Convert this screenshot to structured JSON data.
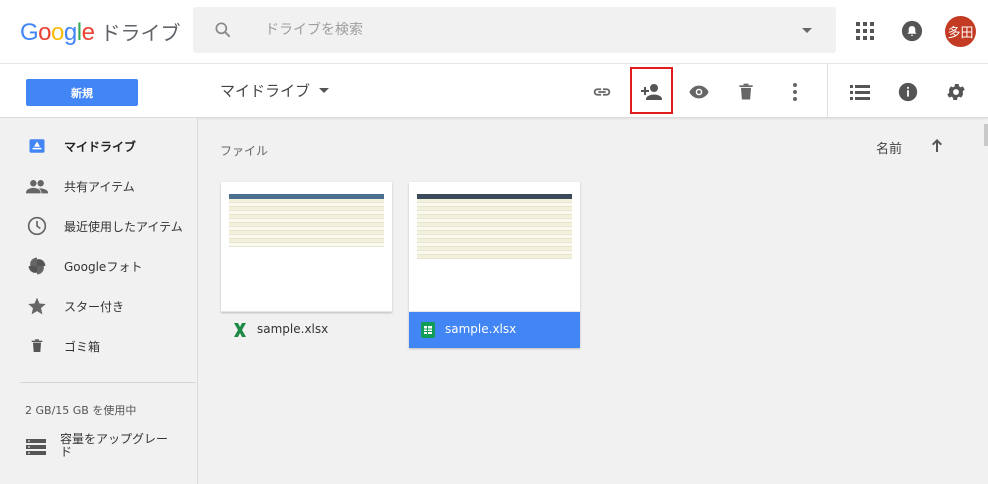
{
  "header": {
    "logo_google": "Google",
    "logo_product": "ドライブ",
    "search_placeholder": "ドライブを検索",
    "avatar_text": "多田"
  },
  "toolbar": {
    "new_label": "新規",
    "breadcrumb": "マイドライブ",
    "icons": [
      "link-icon",
      "add-person-icon",
      "eye-icon",
      "trash-icon",
      "more-vert-icon",
      "list-view-icon",
      "info-icon",
      "settings-icon"
    ],
    "highlighted": "add-person-icon"
  },
  "sidebar": {
    "items": [
      {
        "label": "マイドライブ",
        "icon": "drive-icon",
        "active": true
      },
      {
        "label": "共有アイテム",
        "icon": "people-icon",
        "active": false
      },
      {
        "label": "最近使用したアイテム",
        "icon": "clock-icon",
        "active": false
      },
      {
        "label": "Googleフォト",
        "icon": "photos-icon",
        "active": false
      },
      {
        "label": "スター付き",
        "icon": "star-icon",
        "active": false
      },
      {
        "label": "ゴミ箱",
        "icon": "trash-icon",
        "active": false
      }
    ],
    "storage": "2 GB/15 GB を使用中",
    "upgrade": "容量をアップグレード"
  },
  "main": {
    "section_label": "ファイル",
    "sort_label": "名前",
    "files": [
      {
        "name": "sample.xlsx",
        "type": "excel",
        "selected": false
      },
      {
        "name": "sample.xlsx",
        "type": "google-sheets",
        "selected": true
      }
    ]
  },
  "colors": {
    "accent": "#4285f4",
    "highlight_box": "#e21b1b",
    "avatar": "#c23b22",
    "excel_green": "#1d8a45",
    "sheets_green": "#0f9d58"
  }
}
